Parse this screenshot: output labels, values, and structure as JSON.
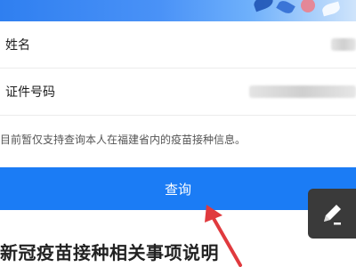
{
  "form": {
    "name_label": "姓名",
    "id_label": "证件号码"
  },
  "notice": "目前暂仅支持查询本人在福建省内的疫苗接种信息。",
  "query_button": "查询",
  "section_title": "新冠疫苗接种相关事项说明",
  "colors": {
    "primary": "#1b7cf5",
    "banner": "#2f7ff0",
    "annotation_arrow": "#e03a3e",
    "fab": "#3a3a3a"
  },
  "icons": {
    "edit": "pencil-icon"
  }
}
